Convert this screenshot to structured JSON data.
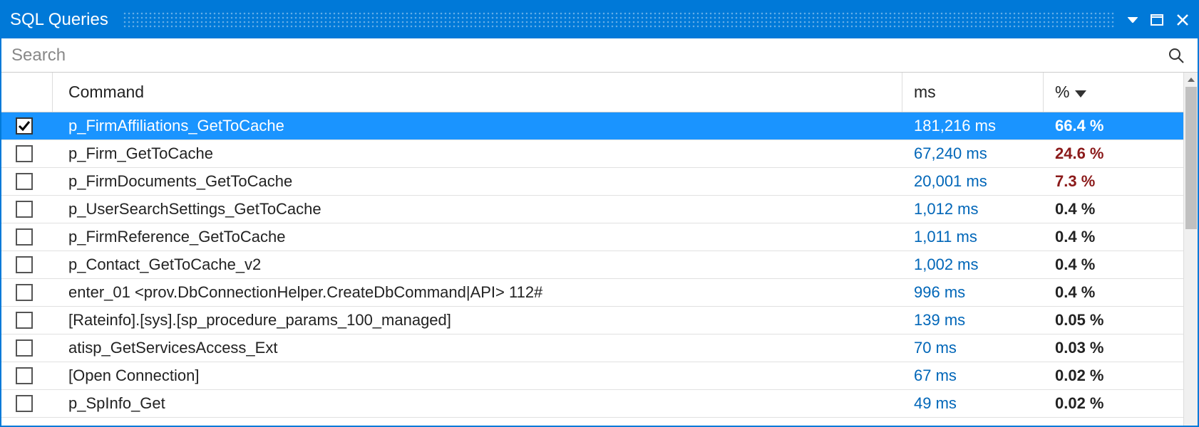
{
  "window": {
    "title": "SQL Queries"
  },
  "search": {
    "placeholder": "Search",
    "value": ""
  },
  "columns": {
    "command": "Command",
    "ms": "ms",
    "percent": "%"
  },
  "sort": {
    "column": "percent",
    "direction": "desc"
  },
  "rows": [
    {
      "checked": true,
      "selected": true,
      "command": "p_FirmAffiliations_GetToCache",
      "ms": "181,216 ms",
      "percent": "66.4 %",
      "hot": false
    },
    {
      "checked": false,
      "selected": false,
      "command": "p_Firm_GetToCache",
      "ms": "67,240 ms",
      "percent": "24.6 %",
      "hot": true
    },
    {
      "checked": false,
      "selected": false,
      "command": "p_FirmDocuments_GetToCache",
      "ms": "20,001 ms",
      "percent": "7.3 %",
      "hot": true
    },
    {
      "checked": false,
      "selected": false,
      "command": "p_UserSearchSettings_GetToCache",
      "ms": "1,012 ms",
      "percent": "0.4 %",
      "hot": false
    },
    {
      "checked": false,
      "selected": false,
      "command": "p_FirmReference_GetToCache",
      "ms": "1,011 ms",
      "percent": "0.4 %",
      "hot": false
    },
    {
      "checked": false,
      "selected": false,
      "command": "p_Contact_GetToCache_v2",
      "ms": "1,002 ms",
      "percent": "0.4 %",
      "hot": false
    },
    {
      "checked": false,
      "selected": false,
      "command": "enter_01 <prov.DbConnectionHelper.CreateDbCommand|API> 112#",
      "ms": "996 ms",
      "percent": "0.4 %",
      "hot": false
    },
    {
      "checked": false,
      "selected": false,
      "command": "[Rateinfo].[sys].[sp_procedure_params_100_managed]",
      "ms": "139 ms",
      "percent": "0.05 %",
      "hot": false
    },
    {
      "checked": false,
      "selected": false,
      "command": "atisp_GetServicesAccess_Ext",
      "ms": "70 ms",
      "percent": "0.03 %",
      "hot": false
    },
    {
      "checked": false,
      "selected": false,
      "command": "[Open Connection]",
      "ms": "67 ms",
      "percent": "0.02 %",
      "hot": false
    },
    {
      "checked": false,
      "selected": false,
      "command": "p_SpInfo_Get",
      "ms": "49 ms",
      "percent": "0.02 %",
      "hot": false
    }
  ]
}
